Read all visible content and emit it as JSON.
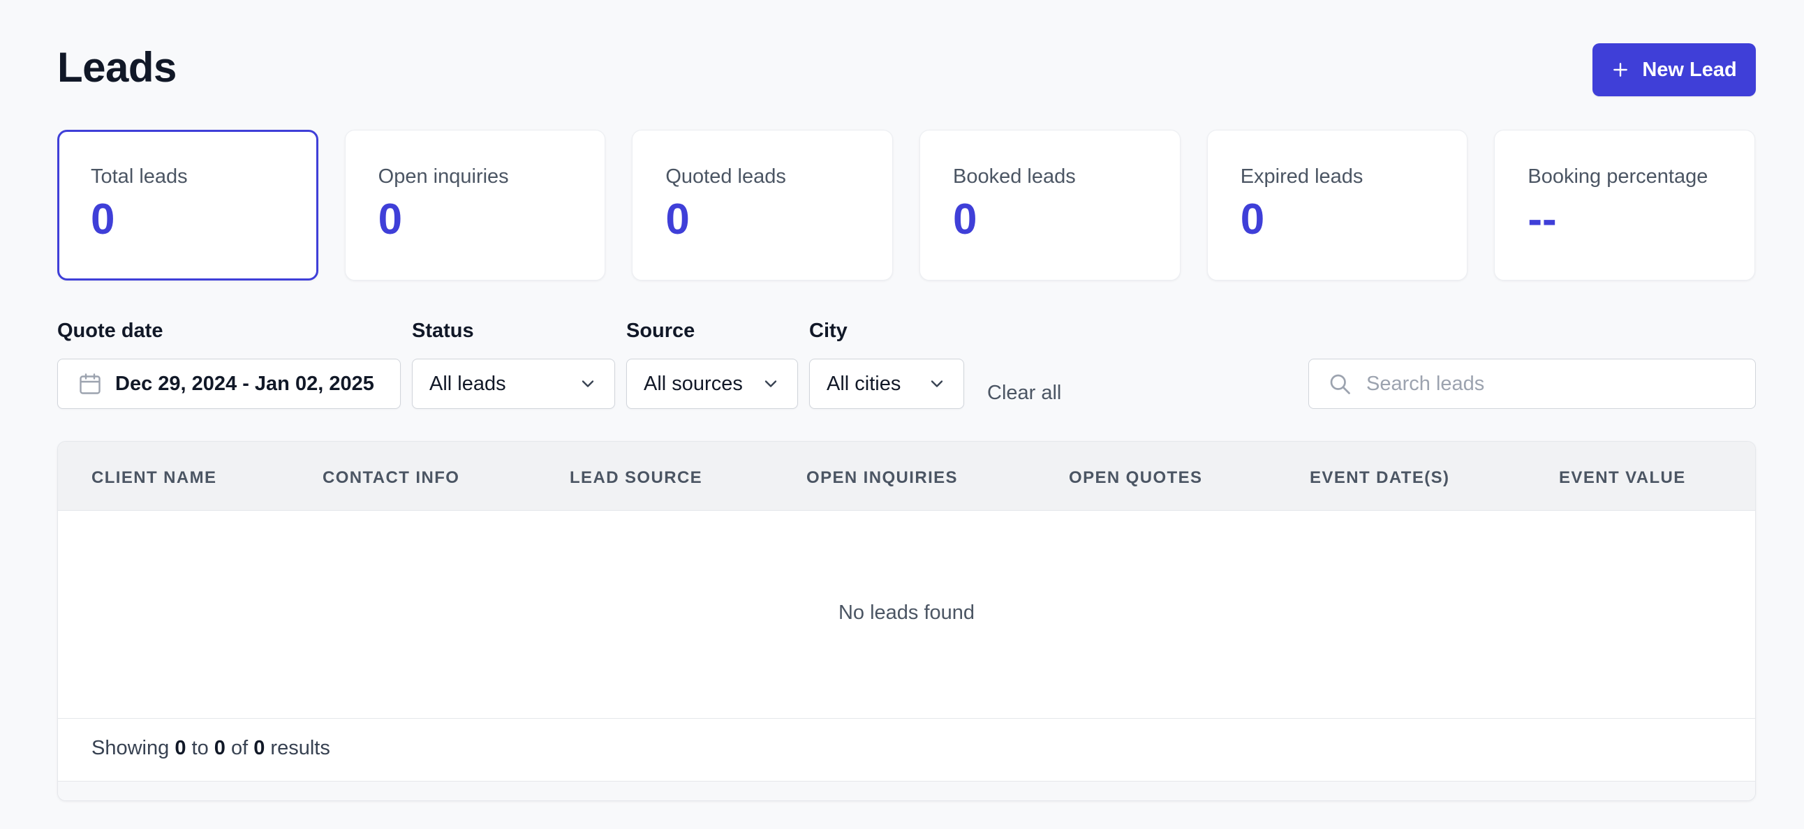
{
  "header": {
    "title": "Leads",
    "new_lead_label": "New Lead"
  },
  "stats": [
    {
      "label": "Total leads",
      "value": "0",
      "active": true
    },
    {
      "label": "Open inquiries",
      "value": "0"
    },
    {
      "label": "Quoted leads",
      "value": "0"
    },
    {
      "label": "Booked leads",
      "value": "0"
    },
    {
      "label": "Expired leads",
      "value": "0"
    },
    {
      "label": "Booking percentage",
      "value": "--"
    }
  ],
  "filters": {
    "quote_date": {
      "label": "Quote date",
      "value": "Dec 29, 2024 - Jan 02, 2025"
    },
    "status": {
      "label": "Status",
      "value": "All leads"
    },
    "source": {
      "label": "Source",
      "value": "All sources"
    },
    "city": {
      "label": "City",
      "value": "All cities"
    },
    "clear_all": "Clear all",
    "search": {
      "placeholder": "Search leads",
      "value": ""
    }
  },
  "table": {
    "columns": [
      "CLIENT NAME",
      "CONTACT INFO",
      "LEAD SOURCE",
      "OPEN INQUIRIES",
      "OPEN QUOTES",
      "EVENT DATE(S)",
      "EVENT VALUE"
    ],
    "empty_message": "No leads found",
    "footer": {
      "showing": "Showing",
      "from": "0",
      "to_word": "to",
      "to": "0",
      "of_word": "of",
      "total": "0",
      "results": "results"
    }
  },
  "colors": {
    "accent": "#3f3fd8",
    "background": "#f8f9fb"
  }
}
